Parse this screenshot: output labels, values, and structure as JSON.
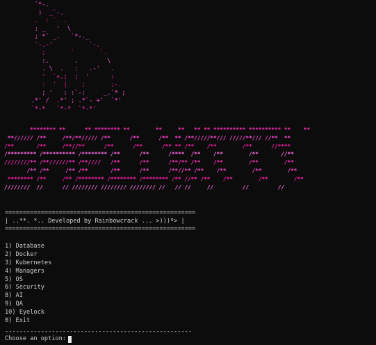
{
  "colors": {
    "background": "#0c0c0c",
    "foreground": "#cccccc",
    "art_gradient": [
      "#ff4fd8",
      "#ff2bc4",
      "#e0148f",
      "#ff5fe0"
    ],
    "banner_gradient": [
      "#ff2fbf",
      "#ff48d8",
      "#ff1fae",
      "#ff6ce6"
    ]
  },
  "cat_art": [
    "        `*-.",
    "         )  _`-.",
    "        .  : `. .",
    "        : _   '  \\",
    "        ; *` _.   `*-._",
    "        `-.-'          `-.",
    "          ;       `       `.",
    "          :.       .        \\",
    "          . \\  .   :   .-'   .",
    "          '  `+.;  ;  '      :",
    "          :  '  |    ;       ;-.",
    "          ; '   : :`-:     _.`* ;",
    "       .*' /  .*' ; .*`- +'  `*'",
    "       `*-*   `*-*  `*-*'"
  ],
  "banner": [
    "        ******** **      ** ******** **        **     **   ** ** ********** ********** **    **",
    " **////// /**     /**/**///// /**      /**      /**  ** /**/////**/// /////**/// //**  **",
    "/**       /**     /**//**      /**      /**      /** ** /**    /**        /**      //****",
    "/********* /********** /******** /**      /**      /****  /**    /**        /**       //**",
    "////////** /**//////** /**////   /**      /**      /**/** /**    /**        /**        /**",
    "       /** /**     /** /**       /**      /**      /**//** /**    /**        /**        /**",
    " ******** /**     /** /******** /******** /******** /** //** /**    /**        /**        /**",
    "////////  //      // //////// //////// //////// //   // //     //         //         //"
  ],
  "info": {
    "border": "=====================================================",
    "text": "| ..**. *.. Developed by Rainbowcrack ... >)))º> |"
  },
  "menu": [
    "1) Database",
    "2) Docker",
    "3) Kubernetes",
    "4) Managers",
    "5) OS",
    "6) Security",
    "8) AI",
    "9) QA",
    "10) Eyelock",
    "0) Exit"
  ],
  "separator": "----------------------------------------------------",
  "prompt": "Choose an option:"
}
